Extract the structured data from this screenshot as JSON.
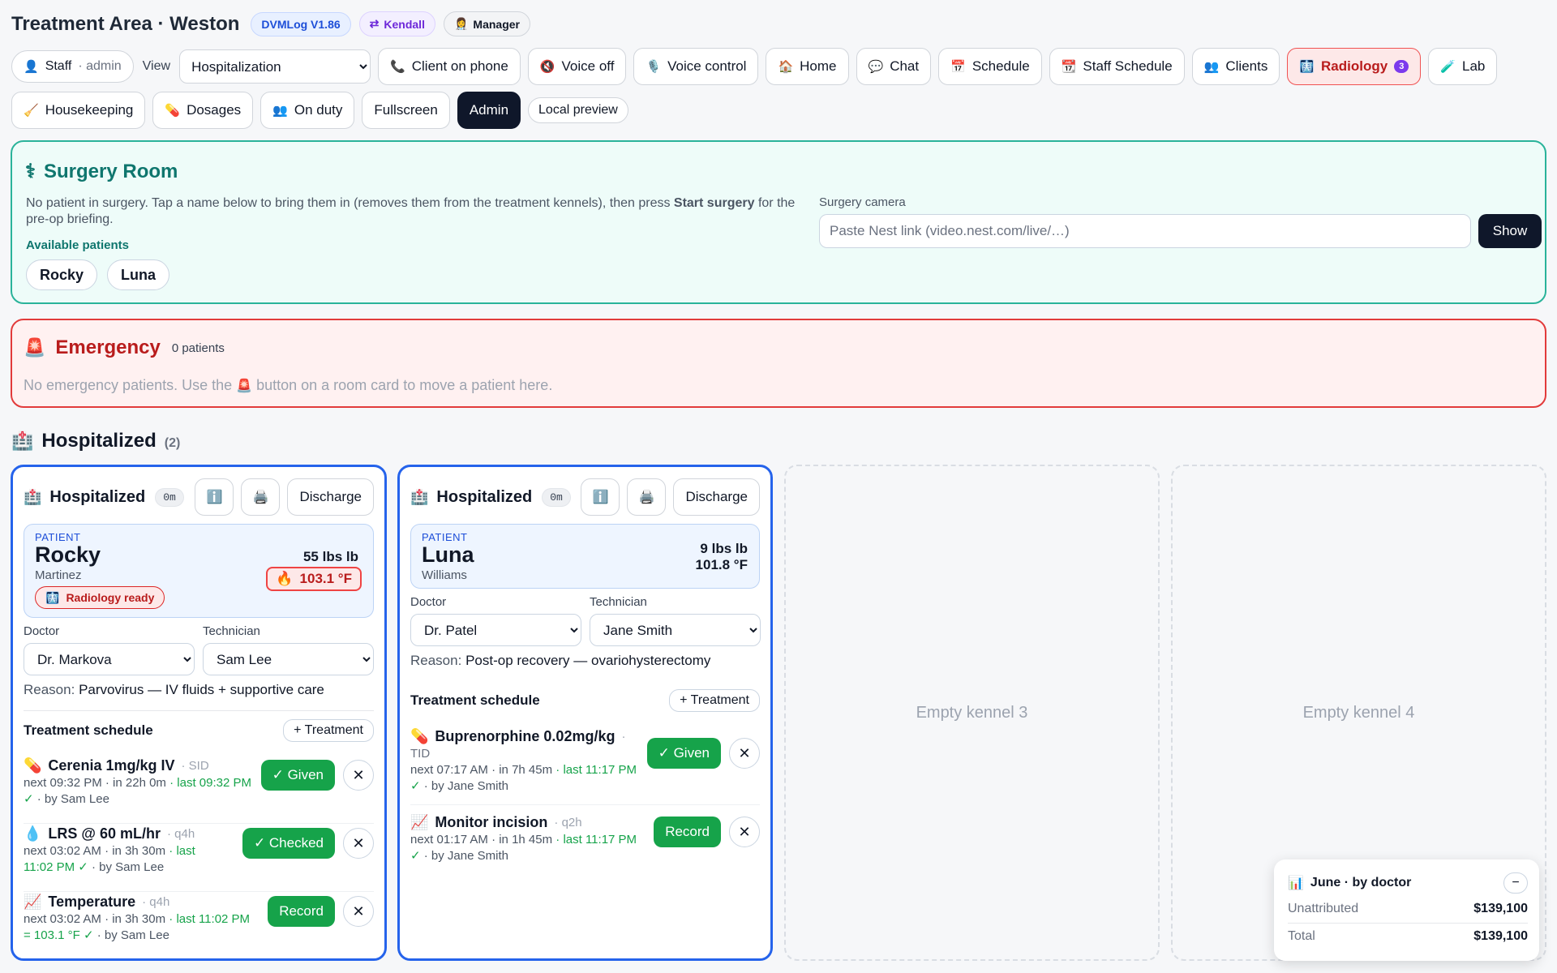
{
  "header": {
    "title": "Treatment Area · Weston",
    "version": "DVMLog V1.86",
    "kendall": "Kendall",
    "manager": "Manager",
    "kendall_icon": "swap-arrows-icon",
    "manager_icon": "manager-icon"
  },
  "nav": {
    "staff_label": "Staff",
    "staff_user": "admin",
    "view_label": "View",
    "view_selected": "Hospitalization",
    "buttons": [
      {
        "label": "Client on phone",
        "icon": "phone-icon",
        "glyph": "📞"
      },
      {
        "label": "Voice off",
        "icon": "speaker-muted-icon",
        "glyph": "🔇"
      },
      {
        "label": "Voice control",
        "icon": "microphone-icon",
        "glyph": "🎙️"
      },
      {
        "label": "Home",
        "icon": "home-icon",
        "glyph": "🏠"
      },
      {
        "label": "Chat",
        "icon": "chat-icon",
        "glyph": "💬"
      },
      {
        "label": "Schedule",
        "icon": "calendar-icon",
        "glyph": "📅"
      },
      {
        "label": "Staff Schedule",
        "icon": "calendar-tear-icon",
        "glyph": "📆"
      },
      {
        "label": "Clients",
        "icon": "people-icon",
        "glyph": "👥"
      },
      {
        "label": "Radiology",
        "icon": "xray-icon",
        "glyph": "🩻",
        "count": "3"
      },
      {
        "label": "Lab",
        "icon": "test-tube-icon",
        "glyph": "🧪"
      }
    ],
    "row2": [
      {
        "label": "Housekeeping",
        "icon": "broom-icon",
        "glyph": "🧹"
      },
      {
        "label": "Dosages",
        "icon": "pill-icon",
        "glyph": "💊"
      },
      {
        "label": "On duty",
        "icon": "people-icon",
        "glyph": "👥"
      }
    ],
    "fullscreen": "Fullscreen",
    "admin": "Admin",
    "local_preview": "Local preview"
  },
  "surgery": {
    "title": "Surgery Room",
    "text_before": "No patient in surgery. Tap a name below to bring them in (removes them from the treatment kennels), then press ",
    "text_bold": "Start surgery",
    "text_after": " for the pre-op briefing.",
    "available_label": "Available patients",
    "patients": [
      "Rocky",
      "Luna"
    ],
    "camera_label": "Surgery camera",
    "camera_placeholder": "Paste Nest link (video.nest.com/live/…)",
    "show_button": "Show"
  },
  "emergency": {
    "title": "Emergency",
    "count": "0 patients",
    "text_before": "No emergency patients. Use the",
    "text_after": "button on a room card to move a patient here."
  },
  "hospitalized": {
    "title": "Hospitalized",
    "count": "(2)",
    "kennels": [
      {
        "label": "Hospitalized",
        "timer": "0m",
        "discharge": "Discharge",
        "patient_label": "PATIENT",
        "name": "Rocky",
        "owner": "Martinez",
        "weight": "55 lbs lb",
        "temp": "103.1 °F",
        "temp_alert": true,
        "badge": "Radiology ready",
        "doctor_label": "Doctor",
        "doctor": "Dr. Markova",
        "tech_label": "Technician",
        "tech": "Sam Lee",
        "reason_label": "Reason:",
        "reason": "Parvovirus — IV fluids + supportive care",
        "schedule_label": "Treatment schedule",
        "add_treatment": "+ Treatment",
        "treatments": [
          {
            "icon": "pill-icon",
            "glyph": "💊",
            "name": "Cerenia 1mg/kg IV",
            "freq": "· SID",
            "meta": "next 09:32 PM · in 22h 0m",
            "last": "· last 09:32 PM ✓",
            "by": "· by Sam Lee",
            "action": "✓ Given"
          },
          {
            "icon": "droplet-icon",
            "glyph": "💧",
            "name": "LRS @ 60 mL/hr",
            "freq": "· q4h",
            "meta": "next 03:02 AM · in 3h 30m",
            "last": "· last 11:02 PM ✓",
            "by": "· by Sam Lee",
            "action": "✓ Checked"
          },
          {
            "icon": "chart-icon",
            "glyph": "📈",
            "name": "Temperature",
            "freq": "· q4h",
            "meta": "next 03:02 AM · in 3h 30m",
            "last": "· last 11:02 PM = 103.1 °F ✓",
            "by": "· by Sam Lee",
            "action": "Record"
          }
        ]
      },
      {
        "label": "Hospitalized",
        "timer": "0m",
        "discharge": "Discharge",
        "patient_label": "PATIENT",
        "name": "Luna",
        "owner": "Williams",
        "weight": "9 lbs lb",
        "temp": "101.8 °F",
        "temp_alert": false,
        "doctor_label": "Doctor",
        "doctor": "Dr. Patel",
        "tech_label": "Technician",
        "tech": "Jane Smith",
        "reason_label": "Reason:",
        "reason": "Post-op recovery — ovariohysterectomy",
        "schedule_label": "Treatment schedule",
        "add_treatment": "+ Treatment",
        "treatments": [
          {
            "icon": "pill-icon",
            "glyph": "💊",
            "name": "Buprenorphine 0.02mg/kg",
            "freq": "·",
            "freq2": "TID",
            "meta": "next 07:17 AM · in 7h 45m",
            "last": "· last 11:17 PM ✓",
            "by": "· by Jane Smith",
            "action": "✓ Given"
          },
          {
            "icon": "chart-icon",
            "glyph": "📈",
            "name": "Monitor incision",
            "freq": "· q2h",
            "meta": "next 01:17 AM · in 1h 45m",
            "last": "· last 11:17 PM ✓",
            "by": "· by Jane Smith",
            "action": "Record"
          }
        ]
      }
    ],
    "empty_kennels": [
      "Empty kennel 3",
      "Empty kennel 4"
    ]
  },
  "summary": {
    "title": "June · by doctor",
    "minimize": "−",
    "rows": [
      {
        "label": "Unattributed",
        "value": "$139,100"
      },
      {
        "label": "Total",
        "value": "$139,100"
      }
    ]
  },
  "colors": {
    "card_border": "#2563eb",
    "surgery_accent": "#0f766e",
    "emergency_accent": "#b91c1c",
    "action_green": "#16a34a"
  }
}
